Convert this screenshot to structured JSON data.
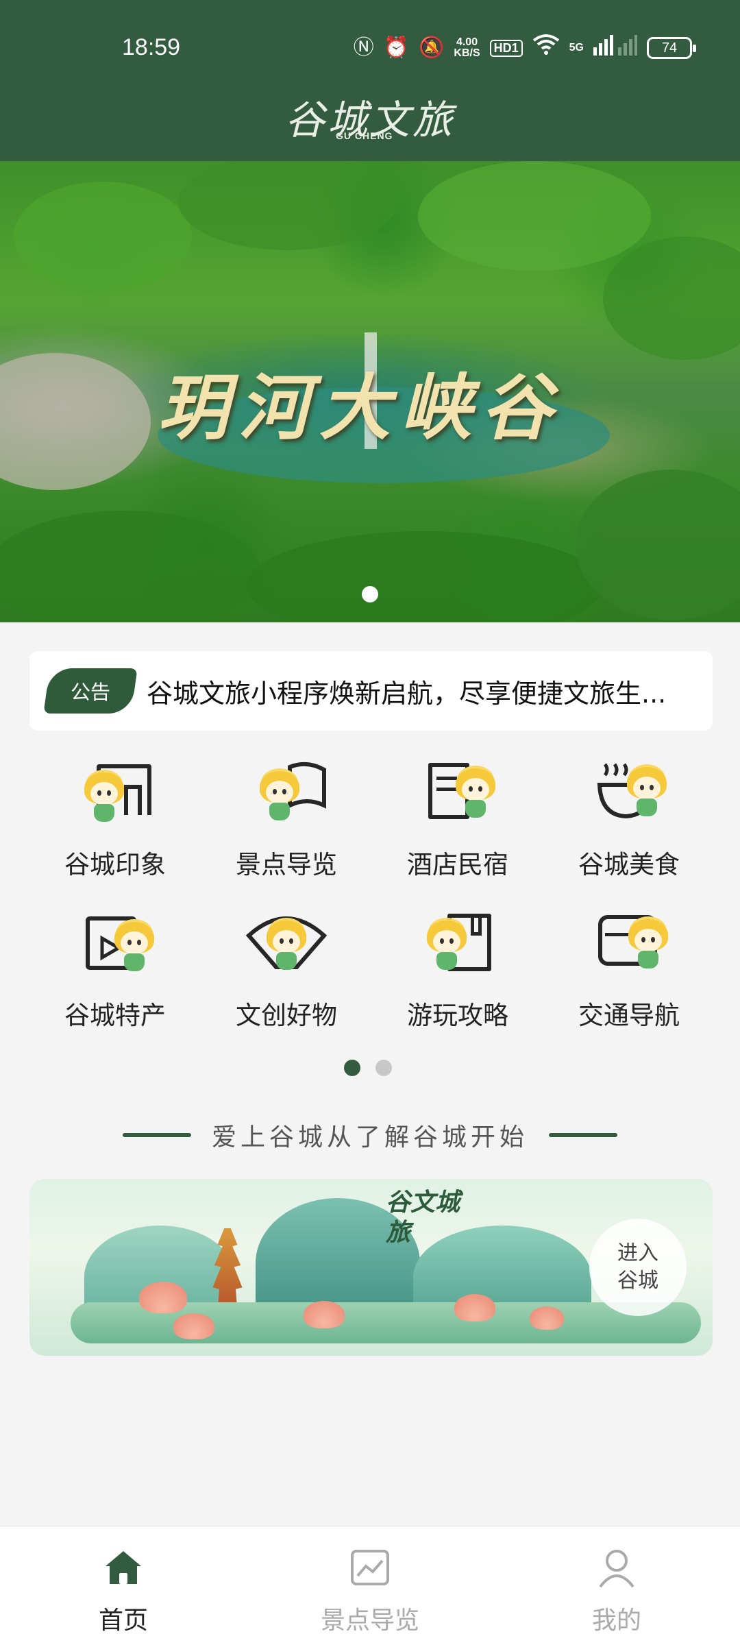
{
  "status_bar": {
    "time": "18:59",
    "net_speed_value": "4.00",
    "net_speed_unit": "KB/S",
    "hd_label": "HD1",
    "signal_label": "5G",
    "battery": "74"
  },
  "header": {
    "logo_cn": "谷城文旅",
    "logo_en": "GU CHENG"
  },
  "banner": {
    "title": "玥河大峡谷",
    "slide_count": 1,
    "active_slide": 1
  },
  "notice": {
    "tag": "公告",
    "text": "谷城文旅小程序焕新启航，尽享便捷文旅生..."
  },
  "menu": {
    "items": [
      {
        "label": "谷城印象",
        "icon": "gate-icon"
      },
      {
        "label": "景点导览",
        "icon": "flag-icon"
      },
      {
        "label": "酒店民宿",
        "icon": "hotel-icon"
      },
      {
        "label": "谷城美食",
        "icon": "food-bowl-icon"
      },
      {
        "label": "谷城特产",
        "icon": "video-bag-icon"
      },
      {
        "label": "文创好物",
        "icon": "fan-icon"
      },
      {
        "label": "游玩攻略",
        "icon": "book-icon"
      },
      {
        "label": "交通导航",
        "icon": "bus-icon"
      }
    ],
    "pages": 2,
    "active_page": 1
  },
  "section": {
    "slogan": "爱上谷城从了解谷城开始"
  },
  "promo": {
    "brand": "谷文城旅",
    "enter_line1": "进入",
    "enter_line2": "谷城"
  },
  "tabbar": {
    "tabs": [
      {
        "label": "首页",
        "icon": "home-icon",
        "active": true
      },
      {
        "label": "景点导览",
        "icon": "picture-icon",
        "active": false
      },
      {
        "label": "我的",
        "icon": "user-icon",
        "active": false
      }
    ]
  },
  "colors": {
    "brand": "#335b3f",
    "background": "#f4f4f4",
    "tab_inactive": "#aaaaaa"
  }
}
